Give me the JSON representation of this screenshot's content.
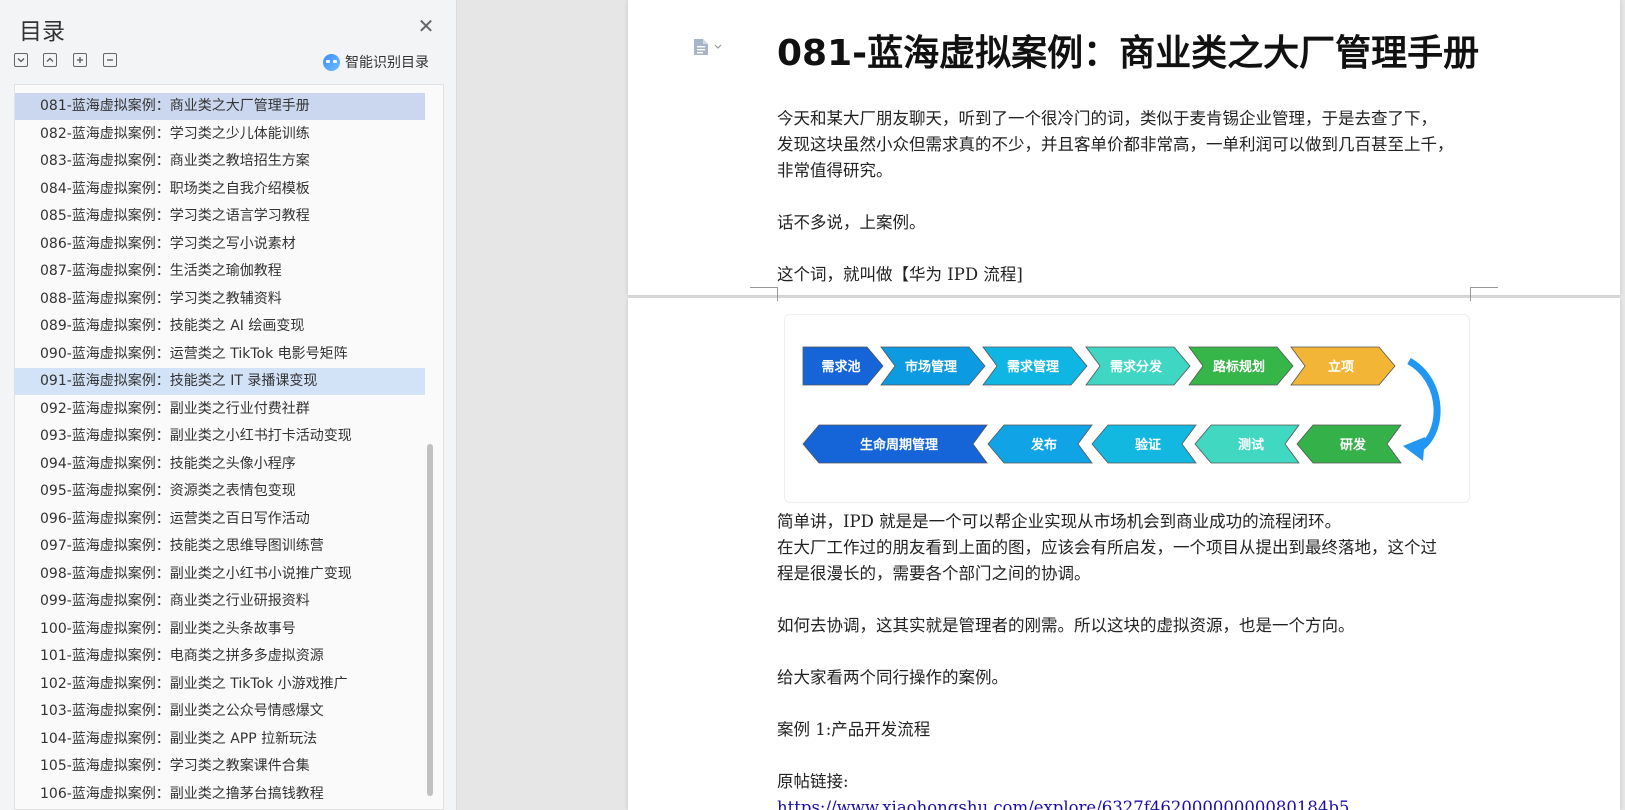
{
  "toc": {
    "title": "目录",
    "smart_label": "智能识别目录",
    "items": [
      "081-蓝海虚拟案例：商业类之大厂管理手册",
      "082-蓝海虚拟案例：学习类之少儿体能训练",
      "083-蓝海虚拟案例：商业类之教培招生方案",
      "084-蓝海虚拟案例：职场类之自我介绍模板",
      "085-蓝海虚拟案例：学习类之语言学习教程",
      "086-蓝海虚拟案例：学习类之写小说素材",
      "087-蓝海虚拟案例：生活类之瑜伽教程",
      "088-蓝海虚拟案例：学习类之教辅资料",
      "089-蓝海虚拟案例：技能类之 AI 绘画变现",
      "090-蓝海虚拟案例：运营类之 TikTok 电影号矩阵",
      "091-蓝海虚拟案例：技能类之 IT 录播课变现",
      "092-蓝海虚拟案例：副业类之行业付费社群",
      "093-蓝海虚拟案例：副业类之小红书打卡活动变现",
      "094-蓝海虚拟案例：技能类之头像小程序",
      "095-蓝海虚拟案例：资源类之表情包变现",
      "096-蓝海虚拟案例：运营类之百日写作活动",
      "097-蓝海虚拟案例：技能类之思维导图训练营",
      "098-蓝海虚拟案例：副业类之小红书小说推广变现",
      "099-蓝海虚拟案例：商业类之行业研报资料",
      "100-蓝海虚拟案例：副业类之头条故事号",
      "101-蓝海虚拟案例：电商类之拼多多虚拟资源",
      "102-蓝海虚拟案例：副业类之 TikTok 小游戏推广",
      "103-蓝海虚拟案例：副业类之公众号情感爆文",
      "104-蓝海虚拟案例：副业类之 APP 拉新玩法",
      "105-蓝海虚拟案例：学习类之教案课件合集",
      "106-蓝海虚拟案例：副业类之撸茅台搞钱教程"
    ]
  },
  "document": {
    "heading": "081-蓝海虚拟案例：商业类之大厂管理手册",
    "p1_l1": "今天和某大厂朋友聊天，听到了一个很冷门的词，类似于麦肯锡企业管理，于是去查了下，",
    "p1_l2": "发现这块虽然小众但需求真的不少，并且客单价都非常高，一单利润可以做到几百甚至上千，",
    "p1_l3": "非常值得研究。",
    "p2": "话不多说，上案例。",
    "p3": "这个词，就叫做【华为 IPD 流程]",
    "p4": "简单讲，IPD 就是是一个可以帮企业实现从市场机会到商业成功的流程闭环。",
    "p5_l1": "在大厂工作过的朋友看到上面的图，应该会有所启发，一个项目从提出到最终落地，这个过",
    "p5_l2": "程是很漫长的，需要各个部门之间的协调。",
    "p6": "如何去协调，这其实就是管理者的刚需。所以这块的虚拟资源，也是一个方向。",
    "p7": "给大家看两个同行操作的案例。",
    "p8": "案例 1:产品开发流程",
    "p9": "原帖链接:",
    "link": "https://www.xiaohongshu.com/explore/6327f46200000000080184b5"
  },
  "flow": {
    "row1": [
      "需求池",
      "市场管理",
      "需求管理",
      "需求分发",
      "路标规划",
      "立项"
    ],
    "row2": [
      "生命周期管理",
      "发布",
      "验证",
      "测试",
      "研发"
    ],
    "colors_row1": [
      "#1565d8",
      "#0c9be0",
      "#10b6e3",
      "#3fd6c3",
      "#36b548",
      "#f3b536"
    ],
    "colors_row2": [
      "#1565d8",
      "#10a4e6",
      "#12b8e0",
      "#40d8c0",
      "#35b14a"
    ],
    "arrow_color": "#2196f3"
  }
}
